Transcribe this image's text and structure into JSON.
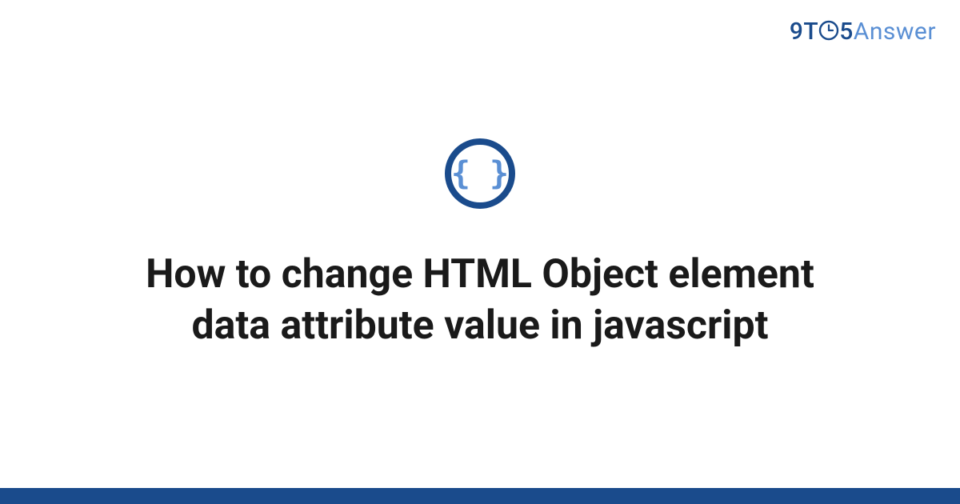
{
  "brand": {
    "part_nine": "9",
    "part_t": "T",
    "part_five": "5",
    "part_answer": "Answer"
  },
  "icon": {
    "name": "code-braces-icon",
    "ring_color": "#1a4b8c",
    "glyph_color": "#5a8fd4"
  },
  "title": "How to change HTML Object element data attribute value in javascript",
  "footer_color": "#1a4b8c"
}
